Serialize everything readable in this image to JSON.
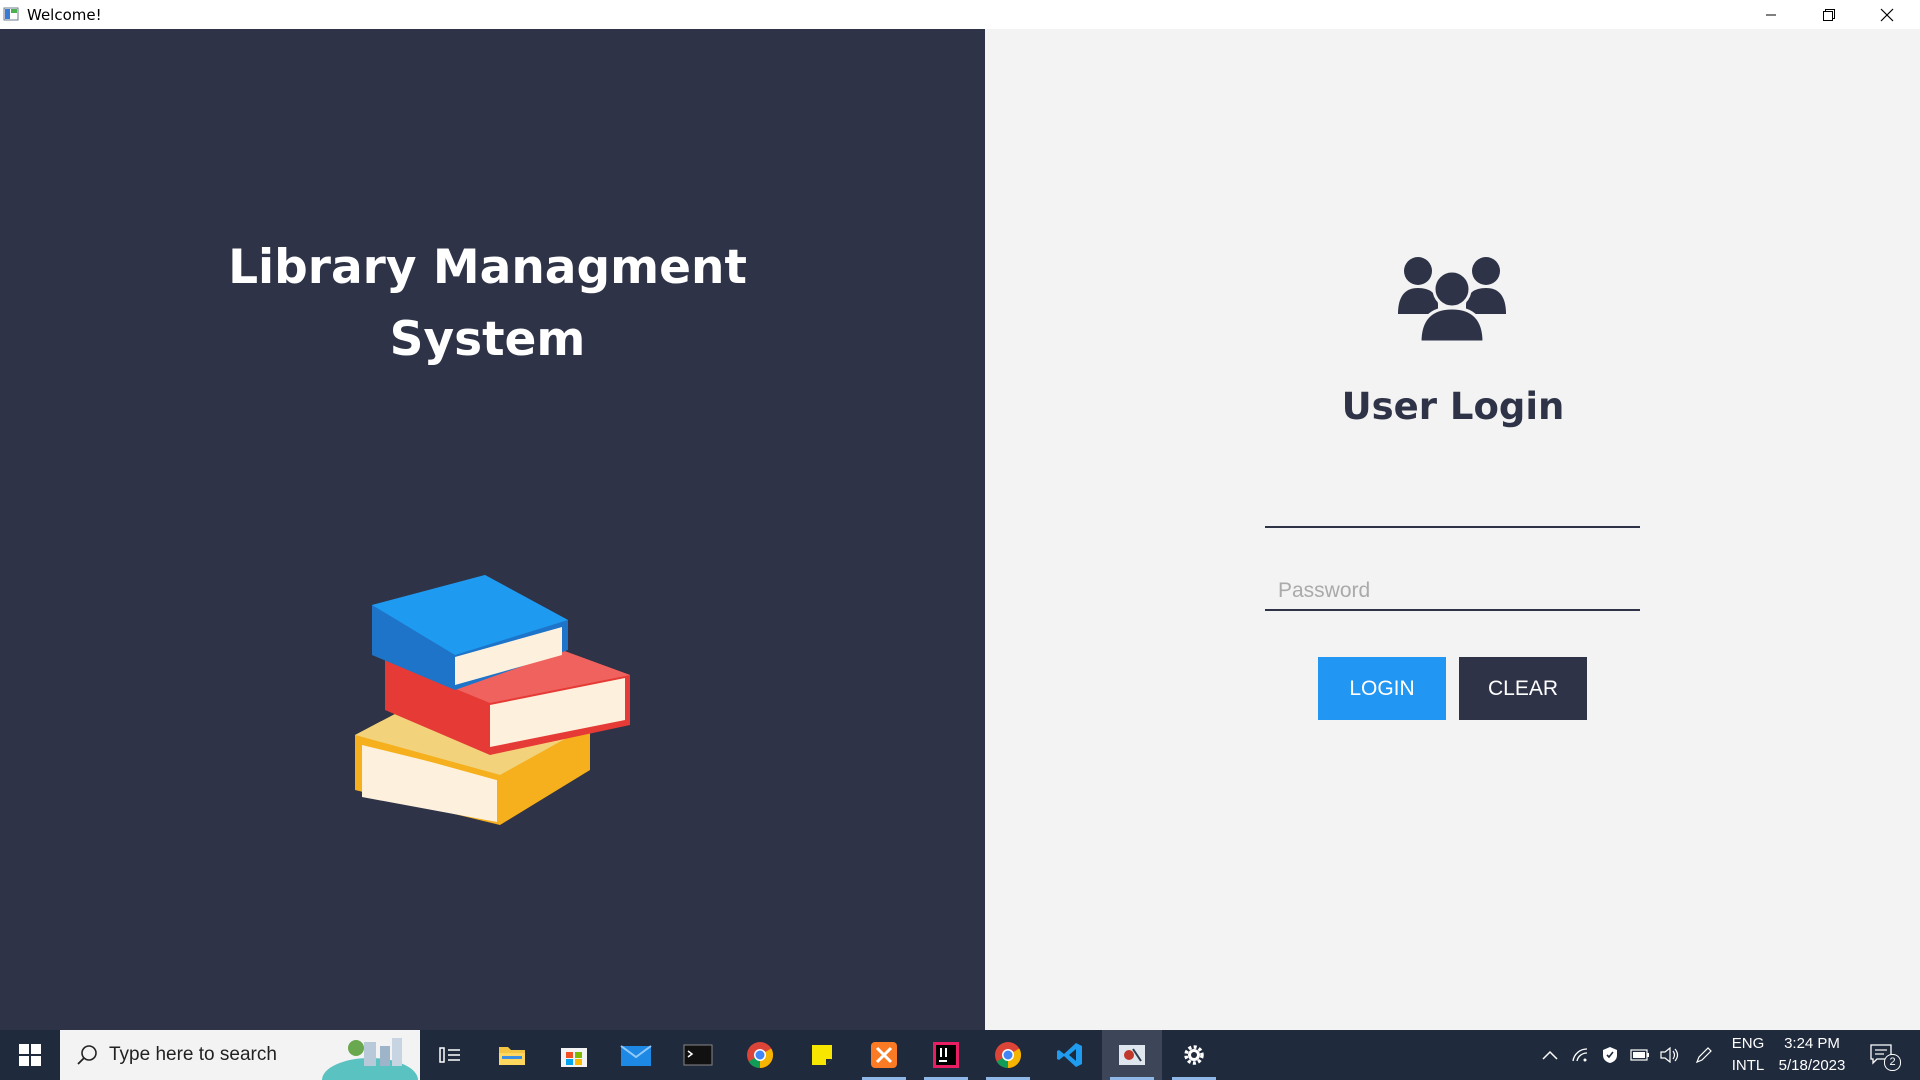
{
  "window": {
    "title": "Welcome!"
  },
  "left_panel": {
    "title_line1": "Library Managment",
    "title_line2": "System"
  },
  "login": {
    "heading": "User Login",
    "username_value": "",
    "username_placeholder": "",
    "password_placeholder": "Password",
    "login_label": "LOGIN",
    "clear_label": "CLEAR"
  },
  "taskbar": {
    "search_placeholder": "Type here to search",
    "language_top": "ENG",
    "language_bottom": "INTL",
    "time": "3:24 PM",
    "date": "5/18/2023",
    "notification_count": "2"
  },
  "colors": {
    "dark_panel": "#2e3347",
    "accent_blue": "#2196f3",
    "light_panel": "#f3f3f3"
  }
}
